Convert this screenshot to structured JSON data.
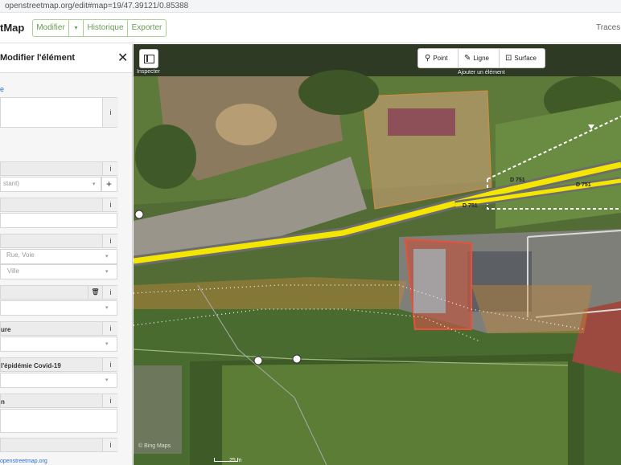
{
  "browser": {
    "url": "openstreetmap.org/edit#map=19/47.39121/0.85388"
  },
  "header": {
    "brand": "tMap",
    "edit_label": "Modifier",
    "caret": "▾",
    "history_label": "Historique",
    "export_label": "Exporter",
    "right_text": "Traces G"
  },
  "sidebar": {
    "title": "Modifier l'élément",
    "close": "✕",
    "top_link": "e",
    "info_glyph": "i",
    "field_placeholder_1": "stant)",
    "plus": "+",
    "street_placeholder": "Rue, Voie",
    "city_placeholder": "Ville",
    "trash": "🗑",
    "section_1": "ure",
    "section_2": "l'épidémie Covid-19",
    "section_3": "n",
    "footer": "openstreetmap.org"
  },
  "map": {
    "inspect_label": "Inspecter",
    "draw_point": "Point",
    "draw_line": "Ligne",
    "draw_area": "Surface",
    "draw_caption": "Ajouter un élément",
    "road_ref_1": "D 751",
    "road_ref_2": "D 751",
    "road_ref_3": "D 751",
    "scale": "25 m",
    "attribution": "© Bing Maps",
    "highlight_color": "#f4e600",
    "selection_color": "#e9503c"
  }
}
